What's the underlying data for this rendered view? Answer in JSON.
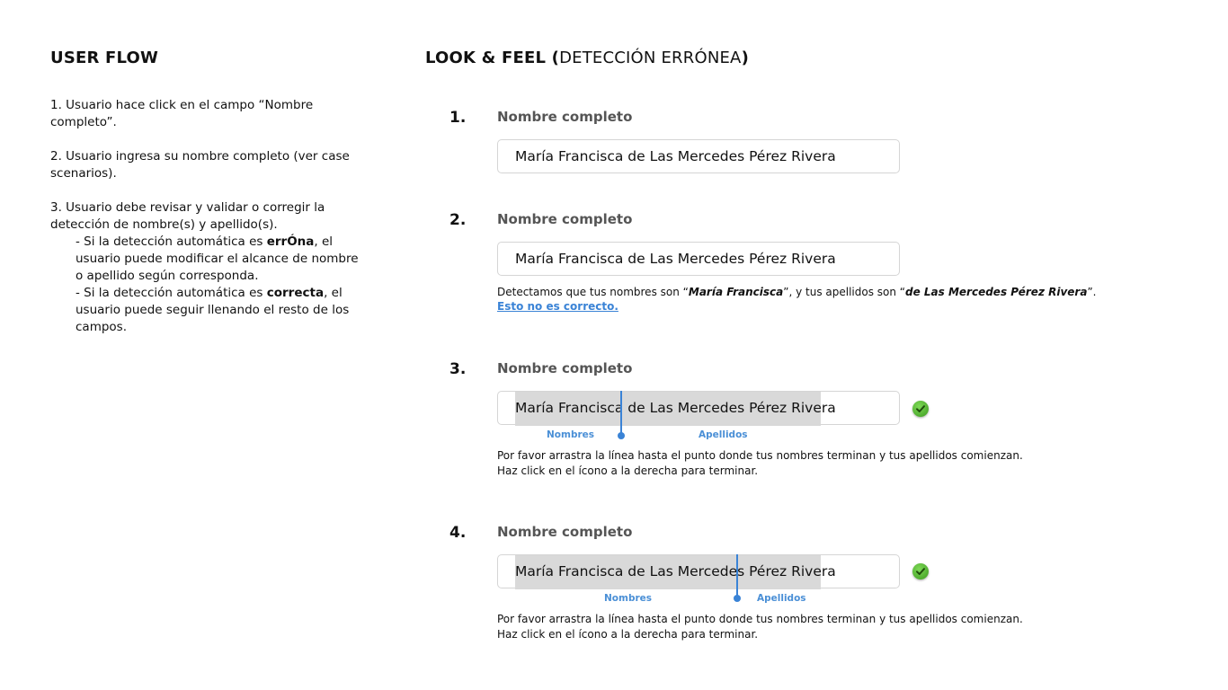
{
  "user_flow": {
    "title": "USER FLOW",
    "step1": "1. Usuario hace click en el campo “Nombre completo”.",
    "step2": "2. Usuario ingresa su nombre completo (ver case scenarios).",
    "step3": "3. Usuario debe revisar y validar o corregir la detección de nombre(s) y apellido(s).",
    "sub1_prefix": "- Si la detección automática es ",
    "sub1_bold": "errÓna",
    "sub1_suffix": ", el usuario  puede modificar el alcance de nombre o apellido según corresponda.",
    "sub2_prefix": "-  Si la detección automática es ",
    "sub2_bold": "correcta",
    "sub2_suffix": ", el usuario puede seguir llenando el resto de los campos."
  },
  "look_feel": {
    "title_bold": "LOOK & FEEL (",
    "title_normal": "DETECCIÓN ERRÓNEA",
    "title_close": ")"
  },
  "steps": [
    {
      "number": "1.",
      "label": "Nombre completo",
      "value": "María Francisca de Las Mercedes Pérez Rivera"
    },
    {
      "number": "2.",
      "label": "Nombre completo",
      "value": "María Francisca de Las Mercedes Pérez Rivera",
      "helper_a": "Detectamos que tus nombres son “",
      "helper_names": "María Francisca",
      "helper_b": "”, y tus apellidos son “",
      "helper_surnames": "de Las Mercedes Pérez Rivera",
      "helper_c": "”.",
      "link": "Esto no es correcto."
    },
    {
      "number": "3.",
      "label": "Nombre completo",
      "value": "María Francisca de Las Mercedes Pérez Rivera",
      "nombres_label": "Nombres",
      "apellidos_label": "Apellidos",
      "helper_line1": "Por favor arrastra la línea hasta el punto donde tus nombres terminan y tus apellidos comienzan.",
      "helper_line2": "Haz click en el ícono a la derecha para terminar.",
      "split_position": 0.35
    },
    {
      "number": "4.",
      "label": "Nombre completo",
      "value": "María Francisca de Las Mercedes Pérez Rivera",
      "nombres_label": "Nombres",
      "apellidos_label": "Apellidos",
      "helper_line1": "Por favor arrastra la línea hasta el punto donde tus nombres terminan y tus apellidos comienzan.",
      "helper_line2": "Haz click en el ícono a la derecha para terminar.",
      "split_position": 0.73
    }
  ],
  "icons": {
    "check": "check-circle-icon",
    "check_color": "#4caf27",
    "accent_color": "#3a83d6"
  }
}
